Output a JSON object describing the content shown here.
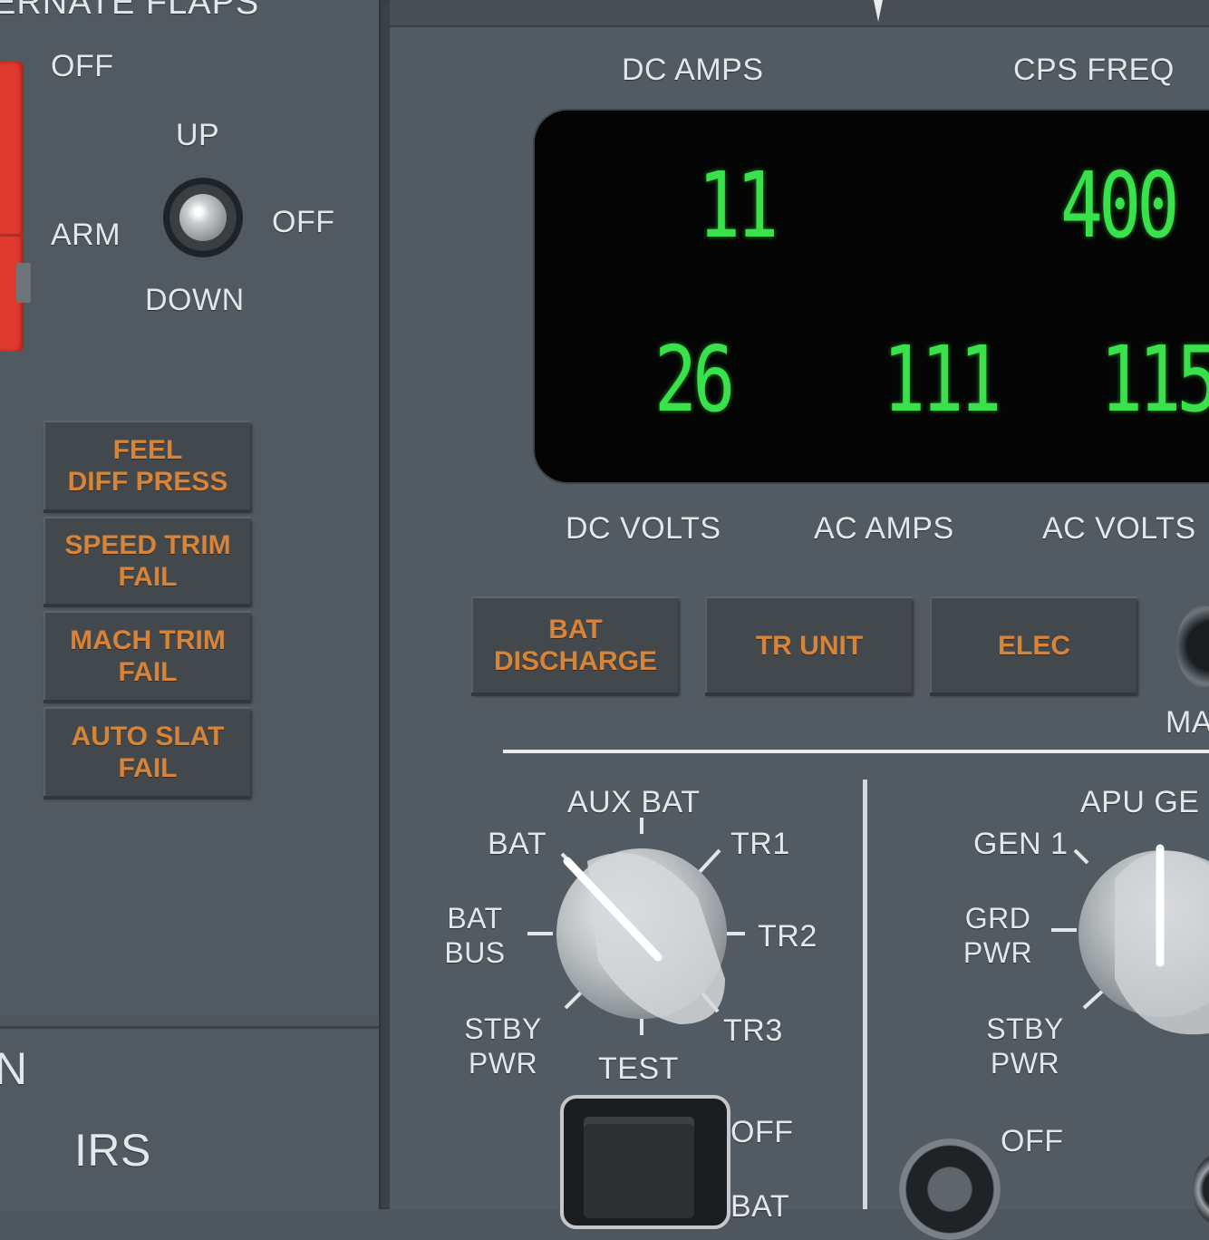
{
  "left_panel": {
    "title": "ERNATE FLAPS",
    "arm_switch": {
      "off_label": "OFF",
      "arm_label": "ARM"
    },
    "flaps_switch": {
      "up_label": "UP",
      "off_label": "OFF",
      "down_label": "DOWN"
    },
    "annunciators": [
      {
        "line1": "FEEL",
        "line2": "DIFF PRESS"
      },
      {
        "line1": "SPEED TRIM",
        "line2": "FAIL"
      },
      {
        "line1": "MACH TRIM",
        "line2": "FAIL"
      },
      {
        "line1": "AUTO SLAT",
        "line2": "FAIL"
      }
    ],
    "lower": {
      "partial_label": "N",
      "irs_label": "IRS"
    }
  },
  "meters": {
    "top_labels": {
      "dc_amps": "DC AMPS",
      "cps_freq": "CPS FREQ"
    },
    "bottom_labels": {
      "dc_volts": "DC VOLTS",
      "ac_amps": "AC AMPS",
      "ac_volts": "AC VOLTS"
    },
    "readouts": {
      "dc_amps": "11",
      "cps_freq": "400",
      "dc_volts": "26",
      "ac_amps": "111",
      "ac_volts": "115"
    },
    "digit_color": "#39e24a"
  },
  "warnings": {
    "bat_discharge": {
      "line1": "BAT",
      "line2": "DISCHARGE"
    },
    "tr_unit": "TR UNIT",
    "elec": "ELEC",
    "maint_partial": "MA"
  },
  "dc_selector": {
    "positions": {
      "aux_bat": "AUX BAT",
      "bat": "BAT",
      "tr1": "TR1",
      "bat_bus_l1": "BAT",
      "bat_bus_l2": "BUS",
      "tr2": "TR2",
      "stby_pwr_l1": "STBY",
      "stby_pwr_l2": "PWR",
      "tr3": "TR3",
      "test": "TEST"
    },
    "selected": "BAT"
  },
  "ac_selector": {
    "positions": {
      "apu_gen": "APU GE",
      "gen1": "GEN 1",
      "grd_pwr_l1": "GRD",
      "grd_pwr_l2": "PWR",
      "stby_pwr_l1": "STBY",
      "stby_pwr_l2": "PWR"
    },
    "selected": "APU GE"
  },
  "battery_switch": {
    "off_label": "OFF",
    "bat_label": "BAT"
  },
  "bottom_switch": {
    "off_label": "OFF"
  },
  "accent_colors": {
    "annunciator_text": "#d6843a",
    "guard_red": "#e0392f"
  }
}
